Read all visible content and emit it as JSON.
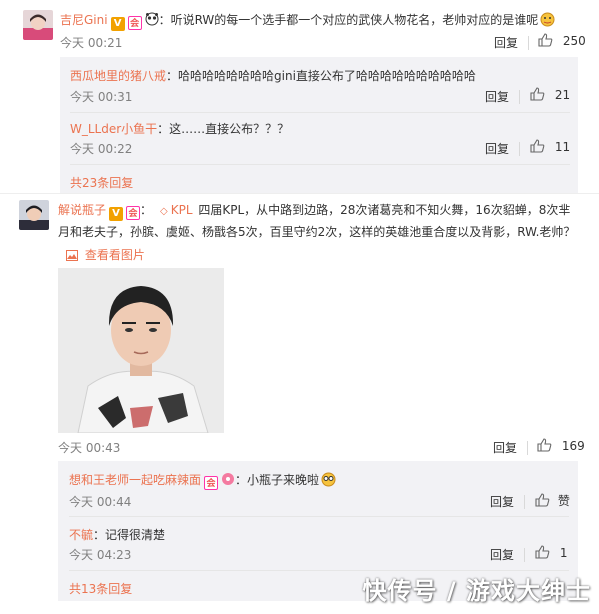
{
  "comment1": {
    "user": "吉尼Gini",
    "text": "：听说RW的每一个选手都一个对应的武侠人物花名，老帅对应的是谁呢",
    "time": "今天 00:21",
    "reply_label": "回复",
    "likes": "250",
    "replies": [
      {
        "user": "西瓜地里的猪八戒",
        "text": "：哈哈哈哈哈哈哈哈gini直接公布了哈哈哈哈哈哈哈哈哈哈",
        "time": "今天 00:31",
        "reply_label": "回复",
        "likes": "21"
      },
      {
        "user": "W_LLder小鱼干",
        "text": "：这……直接公布？？？",
        "time": "今天 00:22",
        "reply_label": "回复",
        "likes": "11"
      }
    ],
    "more": "共23条回复"
  },
  "comment2": {
    "user": "解说瓶子",
    "text_line1_prefix": "：",
    "tag": "KPL",
    "text_line1": "四届KPL，从中路到边路，28次诸葛亮和不知火舞，16次貂蝉，8次芈",
    "text_line2": "月和老夫子，孙膑、虞姬、杨戬各5次，百里守约2次，这样的英雄池重合度以及背影，RW.老帅？",
    "view_image": "查看看图片",
    "time": "今天 00:43",
    "reply_label": "回复",
    "likes": "169",
    "replies": [
      {
        "user": "想和王老师一起吃麻辣面",
        "text": "：小瓶子来晚啦",
        "time": "今天 00:44",
        "reply_label": "回复",
        "likes": "赞"
      },
      {
        "user": "不毓",
        "text": "：记得很清楚",
        "time": "今天 04:23",
        "reply_label": "回复",
        "likes": "1"
      }
    ],
    "more": "共13条回复"
  },
  "watermark": "快传号 / 游戏大绅士",
  "colors": {
    "username": "#eb7350",
    "reply_bg": "#f2f2f5",
    "meta": "#808080"
  }
}
